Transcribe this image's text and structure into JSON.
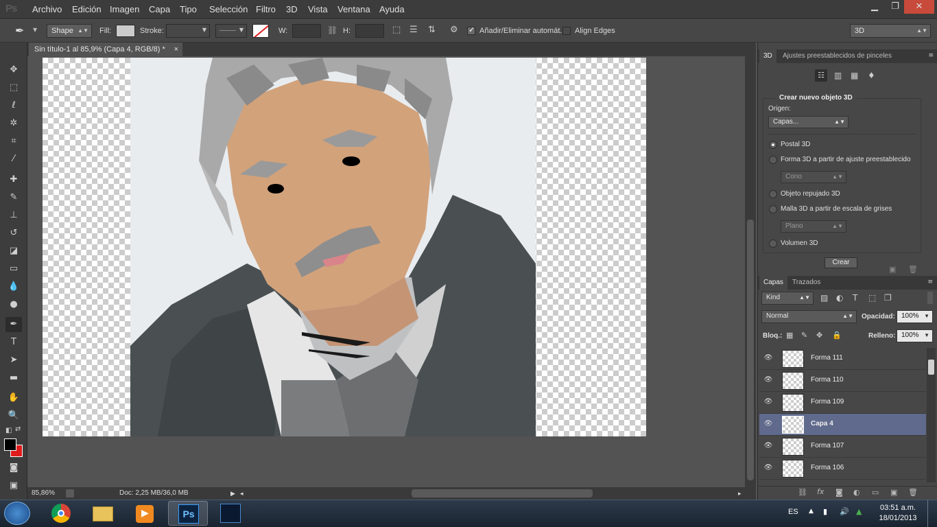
{
  "app": {
    "logo": "Ps"
  },
  "menu": [
    "Archivo",
    "Edición",
    "Imagen",
    "Capa",
    "Tipo",
    "Selección",
    "Filtro",
    "3D",
    "Vista",
    "Ventana",
    "Ayuda"
  ],
  "window_controls": {
    "minimize": "▁",
    "restore": "❐",
    "close": "✕"
  },
  "options": {
    "mode": "Shape",
    "fill_label": "Fill:",
    "stroke_label": "Stroke:",
    "w_label": "W:",
    "h_label": "H:",
    "auto_add_label": "Añadir/Eliminar automát.",
    "align_edges_label": "Align Edges",
    "workspace": "3D",
    "auto_add_checked": true,
    "align_edges_checked": false
  },
  "document": {
    "tab_title": "Sin título-1 al 85,9% (Capa 4, RGB/8) *",
    "close": "×"
  },
  "status": {
    "zoom": "85,86%",
    "doc": "Doc: 2,25 MB/36,0 MB"
  },
  "panel3d": {
    "tabs": [
      "3D",
      "Ajustes preestablecidos de pinceles"
    ],
    "section_title": "Crear nuevo objeto 3D",
    "origin_label": "Origen:",
    "origin_value": "Capas...",
    "options": [
      {
        "label": "Postal 3D",
        "selected": true
      },
      {
        "label": "Forma 3D a partir de ajuste preestablecido",
        "selected": false
      },
      {
        "label": "Objeto repujado 3D",
        "selected": false
      },
      {
        "label": "Malla 3D a partir de escala de grises",
        "selected": false
      },
      {
        "label": "Volumen 3D",
        "selected": false
      }
    ],
    "preset_shape": "Cono",
    "preset_mesh": "Plano",
    "create_button": "Crear"
  },
  "layers_panel": {
    "tabs": [
      "Capas",
      "Trazados"
    ],
    "filter": "Kind",
    "blend_mode": "Normal",
    "opacity_label": "Opacidad:",
    "opacity": "100%",
    "lock_label": "Bloq.:",
    "fill_label": "Relleno:",
    "fill": "100%",
    "layers": [
      {
        "name": "Forma 111",
        "selected": false
      },
      {
        "name": "Forma 110",
        "selected": false
      },
      {
        "name": "Forma 109",
        "selected": false
      },
      {
        "name": "Capa 4",
        "selected": true
      },
      {
        "name": "Forma 107",
        "selected": false
      },
      {
        "name": "Forma 106",
        "selected": false
      }
    ]
  },
  "taskbar": {
    "lang": "ES",
    "time": "03:51 a.m.",
    "date": "18/01/2013"
  },
  "colors": {
    "foreground": "#000000",
    "background": "#e01b1b",
    "selection": "#5f6a8c"
  }
}
